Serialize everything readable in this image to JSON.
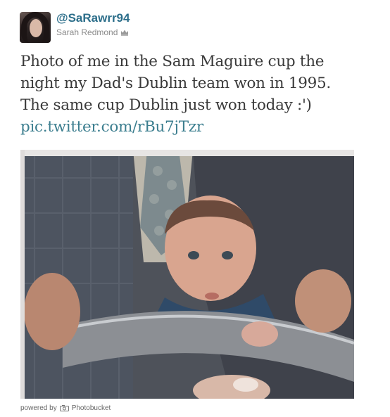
{
  "tweet": {
    "handle": "@SaRawrr94",
    "display_name": "Sarah Redmond",
    "text_lines": [
      "Photo of me in the Sam Maguire cup the",
      "night my Dad's Dublin team won in 1995.",
      "The same cup Dublin just won today :')"
    ],
    "link": "pic.twitter.com/rBu7jTzr",
    "verified_icon": "crown-icon"
  },
  "footer": {
    "powered_by": "powered by",
    "service": "Photobucket",
    "icon": "camera-icon"
  },
  "colors": {
    "handle": "#2c6e8a",
    "link": "#3c7e8f",
    "text": "#3a3a3a",
    "meta": "#8a8a8a"
  }
}
